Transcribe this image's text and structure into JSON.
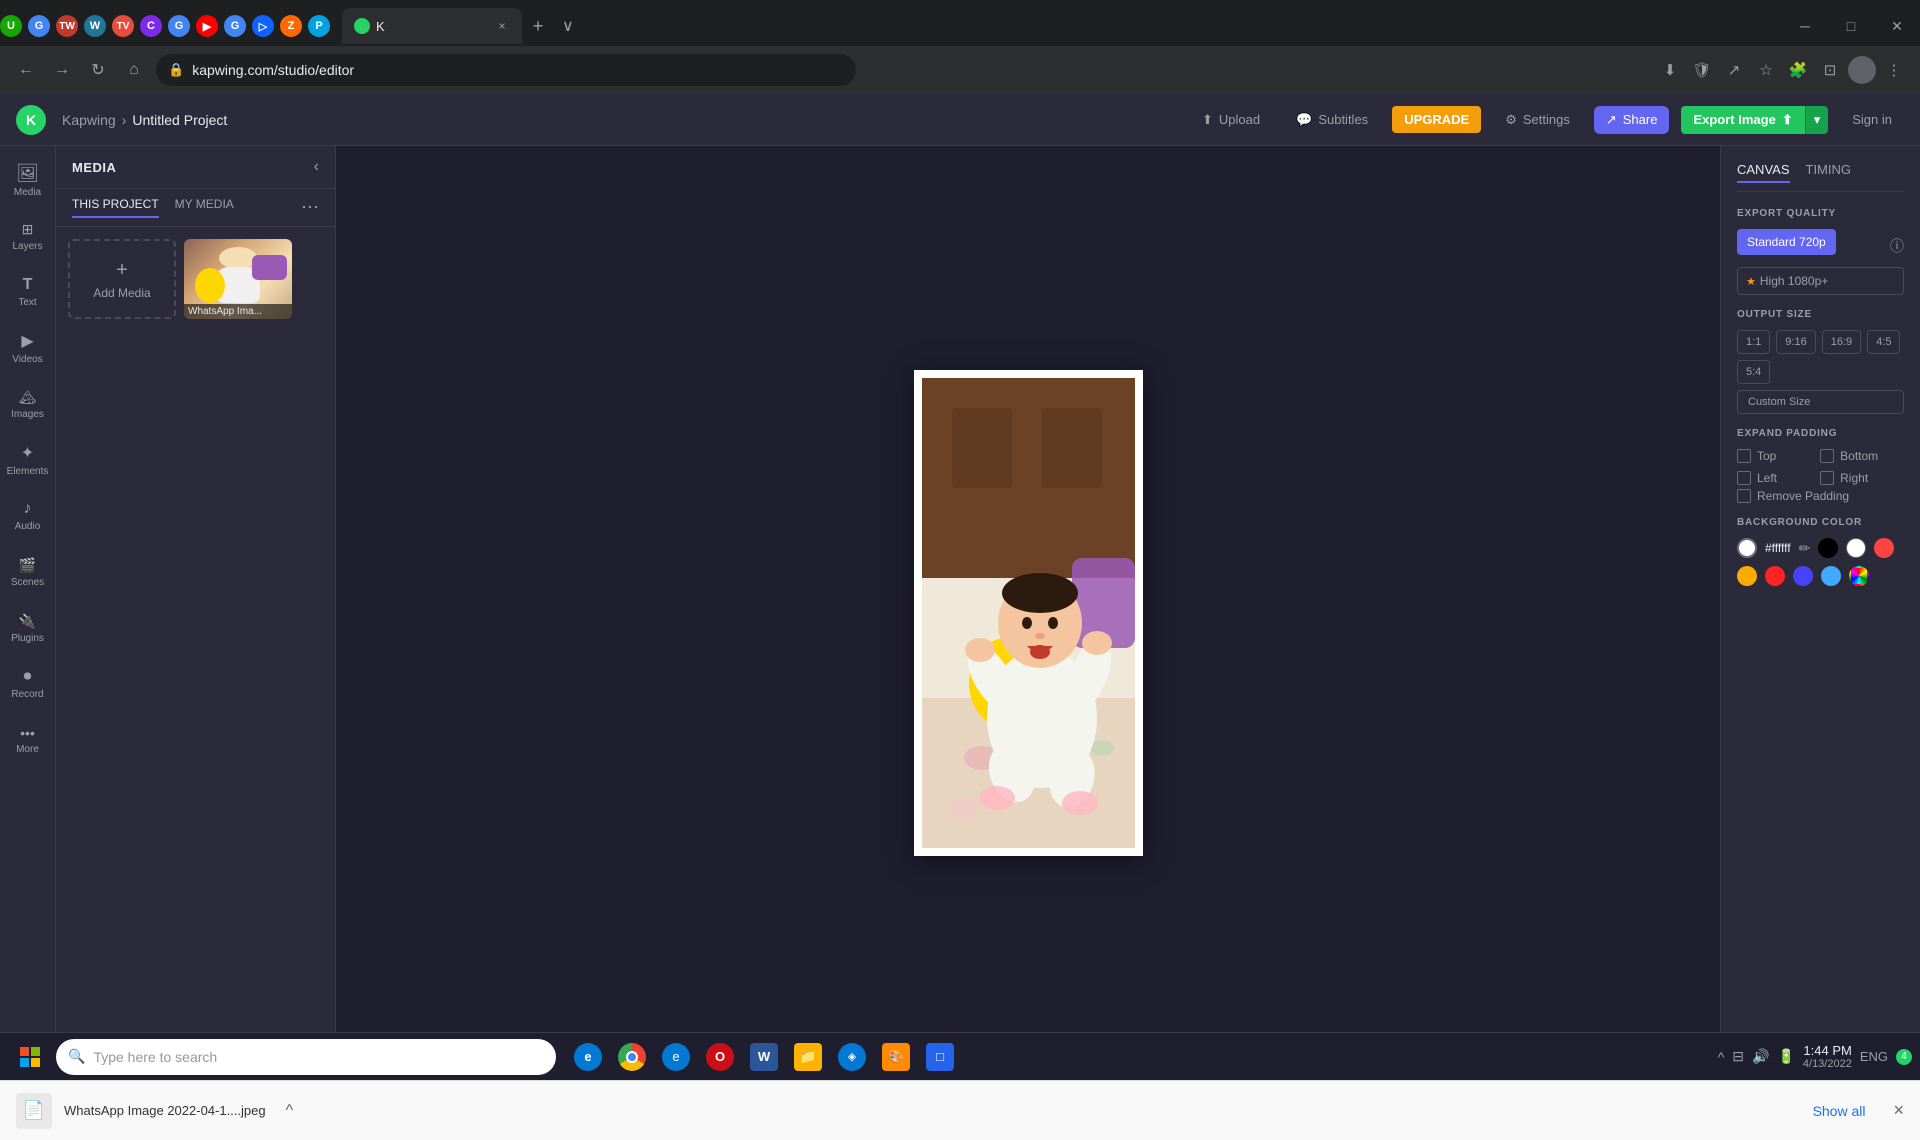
{
  "browser": {
    "tabs": [
      {
        "label": "Upwork",
        "color": "#14a800",
        "active": false
      },
      {
        "label": "Google",
        "color": "#4285f4",
        "active": false
      },
      {
        "label": "Task Hero",
        "color": "#c0392b",
        "active": false
      },
      {
        "label": "WordPress",
        "color": "#21759b",
        "active": false
      },
      {
        "label": "TaskVid",
        "color": "#e74c3c",
        "active": false
      },
      {
        "label": "Canva",
        "color": "#7d2ae8",
        "active": false
      },
      {
        "label": "Google",
        "color": "#4285f4",
        "active": false
      },
      {
        "label": "YouTube",
        "color": "#ff0000",
        "active": false
      },
      {
        "label": "Google",
        "color": "#4285f4",
        "active": false
      },
      {
        "label": "Pipefy",
        "color": "#0f62fe",
        "active": false
      },
      {
        "label": "Zapramp",
        "color": "#ff6900",
        "active": false
      },
      {
        "label": "PandaDoc",
        "color": "#00a3e0",
        "active": false
      },
      {
        "label": "Kapwing",
        "color": "#25d366",
        "active": true
      }
    ],
    "url": "kapwing.com/studio/editor",
    "tab_close_label": "×",
    "tab_add_label": "+"
  },
  "header": {
    "logo_text": "K",
    "app_name": "Kapwing",
    "breadcrumb_sep": "›",
    "project_name": "Untitled Project",
    "upload_label": "Upload",
    "subtitles_label": "Subtitles",
    "upgrade_label": "UPGRADE",
    "settings_label": "Settings",
    "share_label": "Share",
    "export_label": "Export Image",
    "signin_label": "Sign in"
  },
  "sidebar": {
    "items": [
      {
        "icon": "🖼",
        "label": "Media"
      },
      {
        "icon": "⊞",
        "label": "Layers"
      },
      {
        "icon": "T",
        "label": "Text"
      },
      {
        "icon": "▶",
        "label": "Videos"
      },
      {
        "icon": "🖼",
        "label": "Images"
      },
      {
        "icon": "✦",
        "label": "Elements"
      },
      {
        "icon": "♪",
        "label": "Audio"
      },
      {
        "icon": "🎬",
        "label": "Scenes"
      },
      {
        "icon": "🔌",
        "label": "Plugins"
      },
      {
        "icon": "⏺",
        "label": "Record"
      },
      {
        "icon": "•••",
        "label": "More"
      }
    ]
  },
  "media_panel": {
    "title": "MEDIA",
    "tabs": [
      {
        "label": "THIS PROJECT",
        "active": true
      },
      {
        "label": "MY MEDIA",
        "active": false
      }
    ],
    "add_media_label": "Add Media",
    "media_items": [
      {
        "name": "WhatsApp Ima...",
        "has_thumb": true
      }
    ]
  },
  "right_panel": {
    "tabs": [
      {
        "label": "CANVAS",
        "active": true
      },
      {
        "label": "TIMING",
        "active": false
      }
    ],
    "export_quality_label": "EXPORT QUALITY",
    "quality_standard": "Standard 720p",
    "quality_high": "High 1080p+",
    "output_size_label": "OUTPUT SIZE",
    "sizes": [
      "1:1",
      "9:16",
      "16:9",
      "4:5",
      "5:4"
    ],
    "custom_size_label": "Custom Size",
    "expand_padding_label": "EXPAND PADDING",
    "padding_options": [
      "Top",
      "Bottom",
      "Left",
      "Right"
    ],
    "remove_padding_label": "Remove Padding",
    "background_color_label": "BACKGROUND COLOR",
    "color_value": "#ffffff",
    "colors": [
      {
        "hex": "#ffffff",
        "label": "white"
      },
      {
        "hex": "#000000",
        "label": "black"
      },
      {
        "hex": "#ffffff",
        "label": "white2"
      },
      {
        "hex": "#ff4444",
        "label": "red"
      },
      {
        "hex": "#ffaa00",
        "label": "orange"
      },
      {
        "hex": "#ff2222",
        "label": "red2"
      },
      {
        "hex": "#4444ff",
        "label": "blue"
      },
      {
        "hex": "#44aaff",
        "label": "light-blue"
      },
      {
        "hex": "rainbow",
        "label": "rainbow"
      }
    ]
  },
  "download_bar": {
    "filename": "WhatsApp Image 2022-04-1....jpeg",
    "expand_icon": "^",
    "show_all_label": "Show all",
    "close_label": "×"
  },
  "taskbar": {
    "search_placeholder": "Type here to search",
    "time": "1:44 PM",
    "date": "4/13/2022",
    "language": "ENG",
    "notification_count": "4"
  }
}
